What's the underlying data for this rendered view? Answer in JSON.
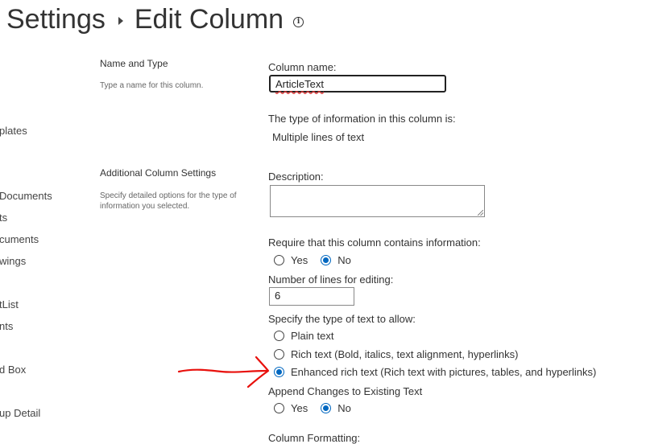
{
  "header": {
    "breadcrumb_parent": "Settings",
    "page_title": "Edit Column"
  },
  "nav": {
    "items": [
      "plates",
      "Documents",
      "ts",
      "cuments",
      "wings",
      "tList",
      "nts",
      "d Box",
      "up Detail"
    ]
  },
  "sections": {
    "name_type": {
      "title": "Name and Type",
      "description": "Type a name for this column."
    },
    "additional": {
      "title": "Additional Column Settings",
      "description": "Specify detailed options for the type of information you selected."
    }
  },
  "form": {
    "column_name_label": "Column name:",
    "column_name_value": "ArticleText",
    "type_info_label": "The type of information in this column is:",
    "type_info_value": "Multiple lines of text",
    "description_label": "Description:",
    "description_value": "",
    "require_label": "Require that this column contains information:",
    "require_options": {
      "yes": "Yes",
      "no": "No",
      "selected": "No"
    },
    "lines_label": "Number of lines for editing:",
    "lines_value": "6",
    "text_type_label": "Specify the type of text to allow:",
    "text_type_options": {
      "plain": "Plain text",
      "rich": "Rich text (Bold, italics, text alignment, hyperlinks)",
      "enhanced": "Enhanced rich text (Rich text with pictures, tables, and hyperlinks)",
      "selected": "Enhanced rich text (Rich text with pictures, tables, and hyperlinks)"
    },
    "append_label": "Append Changes to Existing Text",
    "append_options": {
      "yes": "Yes",
      "no": "No",
      "selected": "No"
    },
    "formatting_label": "Column Formatting:"
  },
  "colors": {
    "accent": "#0067c0",
    "annotation": "#e8100c"
  }
}
